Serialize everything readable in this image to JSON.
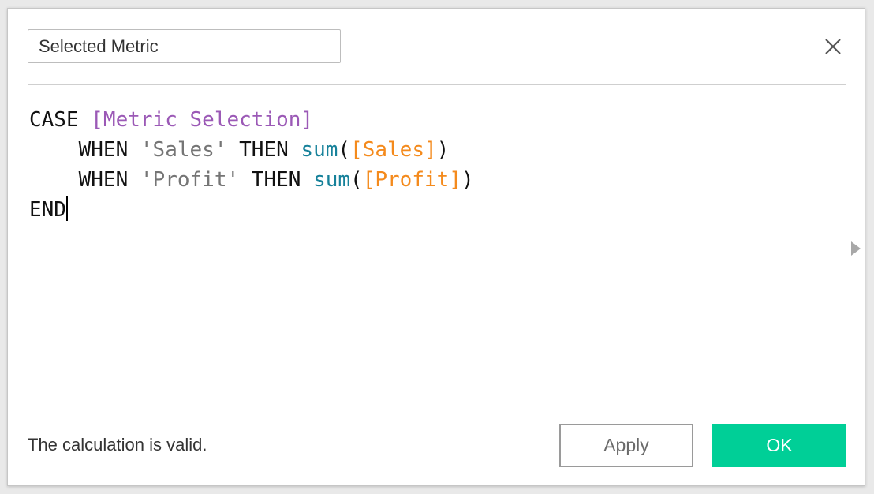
{
  "dialog": {
    "calc_name": "Selected Metric",
    "close_icon": "close-x-icon",
    "expand_icon": "triangle-right-icon"
  },
  "editor": {
    "lines": [
      [
        {
          "type": "kw",
          "text": "CASE"
        },
        {
          "type": "plain",
          "text": " "
        },
        {
          "type": "field-param",
          "text": "[Metric Selection]"
        }
      ],
      [
        {
          "type": "plain",
          "text": "    "
        },
        {
          "type": "kw",
          "text": "WHEN"
        },
        {
          "type": "plain",
          "text": " "
        },
        {
          "type": "str",
          "text": "'Sales'"
        },
        {
          "type": "plain",
          "text": " "
        },
        {
          "type": "kw",
          "text": "THEN"
        },
        {
          "type": "plain",
          "text": " "
        },
        {
          "type": "func",
          "text": "sum"
        },
        {
          "type": "punc",
          "text": "("
        },
        {
          "type": "field",
          "text": "[Sales]"
        },
        {
          "type": "punc",
          "text": ")"
        }
      ],
      [
        {
          "type": "plain",
          "text": "    "
        },
        {
          "type": "kw",
          "text": "WHEN"
        },
        {
          "type": "plain",
          "text": " "
        },
        {
          "type": "str",
          "text": "'Profit'"
        },
        {
          "type": "plain",
          "text": " "
        },
        {
          "type": "kw",
          "text": "THEN"
        },
        {
          "type": "plain",
          "text": " "
        },
        {
          "type": "func",
          "text": "sum"
        },
        {
          "type": "punc",
          "text": "("
        },
        {
          "type": "field",
          "text": "[Profit]"
        },
        {
          "type": "punc",
          "text": ")"
        }
      ],
      [
        {
          "type": "kw",
          "text": "END"
        }
      ]
    ],
    "caret_line": 3
  },
  "footer": {
    "status": "The calculation is valid.",
    "apply_label": "Apply",
    "ok_label": "OK"
  },
  "colors": {
    "ok_button": "#00cf97",
    "parameter_field": "#9b59b6",
    "string_literal": "#757575",
    "function": "#16819a",
    "field": "#f48a1c"
  }
}
